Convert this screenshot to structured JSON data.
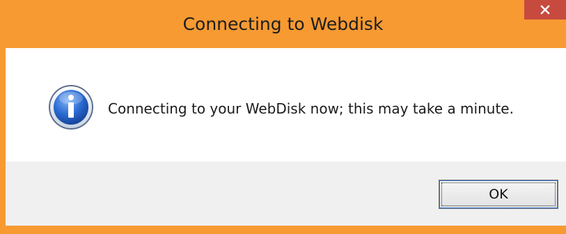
{
  "window": {
    "title": "Connecting to Webdisk"
  },
  "icons": {
    "close": "close-icon",
    "info": "info-icon"
  },
  "dialog": {
    "message": "Connecting to your WebDisk now; this may take a minute.",
    "ok_label": "OK"
  },
  "colors": {
    "frame_accent": "#f79a32",
    "close_button": "#c74a3f",
    "content_background": "#ffffff",
    "footer_background": "#f0f0f0",
    "info_icon_blue": "#1e5fc2"
  }
}
